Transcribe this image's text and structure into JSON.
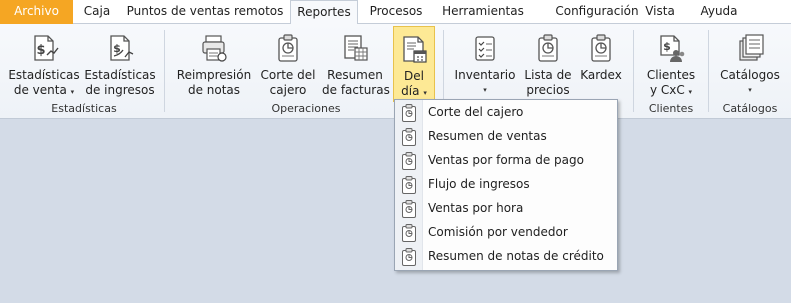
{
  "menu": {
    "archivo": "Archivo",
    "caja": "Caja",
    "puntos": "Puntos de ventas remotos",
    "reportes": "Reportes",
    "procesos": "Procesos",
    "herramientas": "Herramientas",
    "configuracion": "Configuración",
    "vista": "Vista",
    "ayuda": "Ayuda"
  },
  "ribbon": {
    "estadisticas_venta": [
      "Estadísticas",
      "de venta"
    ],
    "estadisticas_ingresos": [
      "Estadísticas",
      "de ingresos"
    ],
    "reimpresion": [
      "Reimpresión",
      "de notas"
    ],
    "corte": [
      "Corte del",
      "cajero"
    ],
    "resumen_facturas": [
      "Resumen",
      "de facturas"
    ],
    "del_dia": [
      "Del",
      "día"
    ],
    "inventario": "Inventario",
    "lista_precios": [
      "Lista de",
      "precios"
    ],
    "kardex": "Kardex",
    "clientes": [
      "Clientes",
      "y CxC"
    ],
    "catalogos": "Catálogos",
    "dropdown_arrow": "▾"
  },
  "groups": {
    "estadisticas": "Estadísticas",
    "operaciones": "Operaciones",
    "clientes": "Clientes",
    "catalogos": "Catálogos"
  },
  "dropdown": {
    "items": [
      "Corte del cajero",
      "Resumen de ventas",
      "Ventas por forma de pago",
      "Flujo de ingresos",
      "Ventas por hora",
      "Comisión por vendedor",
      "Resumen de notas de crédito"
    ]
  },
  "colors": {
    "archivo_tab": "#f5a623",
    "selected_button": "#fde995",
    "background": "#d3dbe7"
  }
}
